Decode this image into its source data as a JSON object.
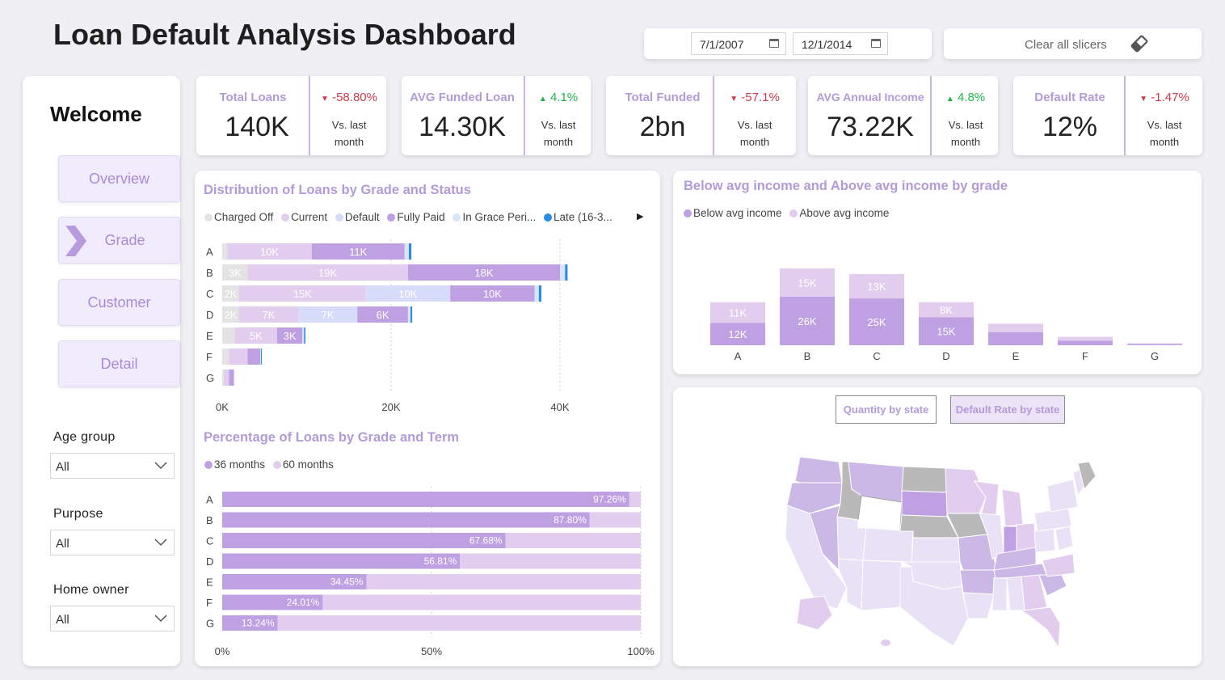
{
  "header": {
    "title": "Loan Default Analysis Dashboard",
    "date_start": "7/1/2007",
    "date_end": "12/1/2014",
    "clear_label": "Clear all slicers"
  },
  "sidebar": {
    "welcome": "Welcome",
    "nav": [
      {
        "label": "Overview",
        "active": false
      },
      {
        "label": "Grade",
        "active": true
      },
      {
        "label": "Customer",
        "active": false
      },
      {
        "label": "Detail",
        "active": false
      }
    ],
    "slicers": [
      {
        "label": "Age group",
        "value": "All"
      },
      {
        "label": "Purpose",
        "value": "All"
      },
      {
        "label": "Home owner",
        "value": "All"
      }
    ]
  },
  "kpis": [
    {
      "title": "Total Loans",
      "value": "140K",
      "change": "-58.80%",
      "direction": "down",
      "vs1": "Vs. last",
      "vs2": "month"
    },
    {
      "title": "AVG Funded Loan",
      "value": "14.30K",
      "change": "4.1%",
      "direction": "up",
      "vs1": "Vs. last",
      "vs2": "month"
    },
    {
      "title": "Total Funded",
      "value": "2bn",
      "change": "-57.1%",
      "direction": "down",
      "vs1": "Vs. last",
      "vs2": "month"
    },
    {
      "title": "AVG Annual Income",
      "value": "73.22K",
      "change": "4.8%",
      "direction": "up",
      "vs1": "Vs. last",
      "vs2": "month"
    },
    {
      "title": "Default Rate",
      "value": "12%",
      "change": "-1.47%",
      "direction": "down",
      "vs1": "Vs. last",
      "vs2": "month"
    }
  ],
  "colors": {
    "accent": "#b39ad8",
    "charged_off": "#e3e3e3",
    "current": "#e2cdee",
    "default": "#d6dcfa",
    "fully_paid": "#bfa0e2",
    "in_grace": "#d7e6f6",
    "late": "#2a8ae6",
    "below": "#bfa0e2",
    "above": "#e2cdee"
  },
  "map": {
    "quantity_button": "Quantity by state",
    "default_rate_button": "Default Rate by state"
  },
  "chart_data": [
    {
      "type": "bar",
      "orientation": "horizontal-stacked",
      "title": "Distribution of Loans by Grade and Status",
      "categories": [
        "A",
        "B",
        "C",
        "D",
        "E",
        "F",
        "G"
      ],
      "series": [
        {
          "name": "Charged Off",
          "values": [
            0.6,
            3,
            2,
            2,
            1.5,
            0.8,
            0.2
          ]
        },
        {
          "name": "Current",
          "values": [
            10,
            19,
            15,
            7,
            5,
            2.2,
            0.6
          ]
        },
        {
          "name": "Default",
          "values": [
            0,
            0,
            10,
            7,
            0,
            0,
            0
          ]
        },
        {
          "name": "Fully Paid",
          "values": [
            11,
            18,
            10,
            6,
            3,
            1.5,
            0.6
          ]
        },
        {
          "name": "In Grace Peri...",
          "values": [
            0.5,
            0.6,
            0.5,
            0.3,
            0.2,
            0.1,
            0
          ]
        },
        {
          "name": "Late (16-3...",
          "values": [
            0.3,
            0.3,
            0.3,
            0.2,
            0.15,
            0.1,
            0
          ]
        }
      ],
      "labels": [
        [
          "",
          "10K",
          "",
          "11K",
          "",
          ""
        ],
        [
          "3K",
          "19K",
          "",
          "18K",
          "",
          ""
        ],
        [
          "2K",
          "15K",
          "10K",
          "10K",
          "",
          ""
        ],
        [
          "2K",
          "7K",
          "7K",
          "6K",
          "",
          ""
        ],
        [
          "",
          "5K",
          "",
          "3K",
          "",
          ""
        ],
        [
          "",
          "",
          "",
          "",
          "",
          ""
        ],
        [
          "",
          "",
          "",
          "",
          "",
          ""
        ]
      ],
      "xlim": [
        0,
        40
      ],
      "x_ticks": [
        "0K",
        "20K",
        "40K"
      ]
    },
    {
      "type": "bar",
      "orientation": "horizontal-100%-stacked",
      "title": "Percentage of Loans by Grade and Term",
      "categories": [
        "A",
        "B",
        "C",
        "D",
        "E",
        "F",
        "G"
      ],
      "series": [
        {
          "name": "36 months",
          "values": [
            97.26,
            87.8,
            67.68,
            56.81,
            34.45,
            24.01,
            13.24
          ]
        },
        {
          "name": "60 months",
          "values": [
            2.74,
            12.2,
            32.32,
            43.19,
            65.55,
            75.99,
            86.76
          ]
        }
      ],
      "labels": [
        "97.26%",
        "87.80%",
        "67.68%",
        "56.81%",
        "34.45%",
        "24.01%",
        "13.24%"
      ],
      "x_ticks": [
        "0%",
        "50%",
        "100%"
      ]
    },
    {
      "type": "bar",
      "orientation": "vertical-stacked",
      "title": "Below avg income and Above avg income by grade",
      "categories": [
        "A",
        "B",
        "C",
        "D",
        "E",
        "F",
        "G"
      ],
      "series": [
        {
          "name": "Below avg income",
          "values": [
            12,
            26,
            25,
            15,
            7,
            2.5,
            0.6
          ],
          "labels": [
            "12K",
            "26K",
            "25K",
            "15K",
            "",
            "",
            ""
          ]
        },
        {
          "name": "Above avg income",
          "values": [
            11,
            15,
            13,
            8,
            4.5,
            2,
            0.5
          ],
          "labels": [
            "11K",
            "15K",
            "13K",
            "8K",
            "",
            "",
            ""
          ]
        }
      ]
    }
  ]
}
